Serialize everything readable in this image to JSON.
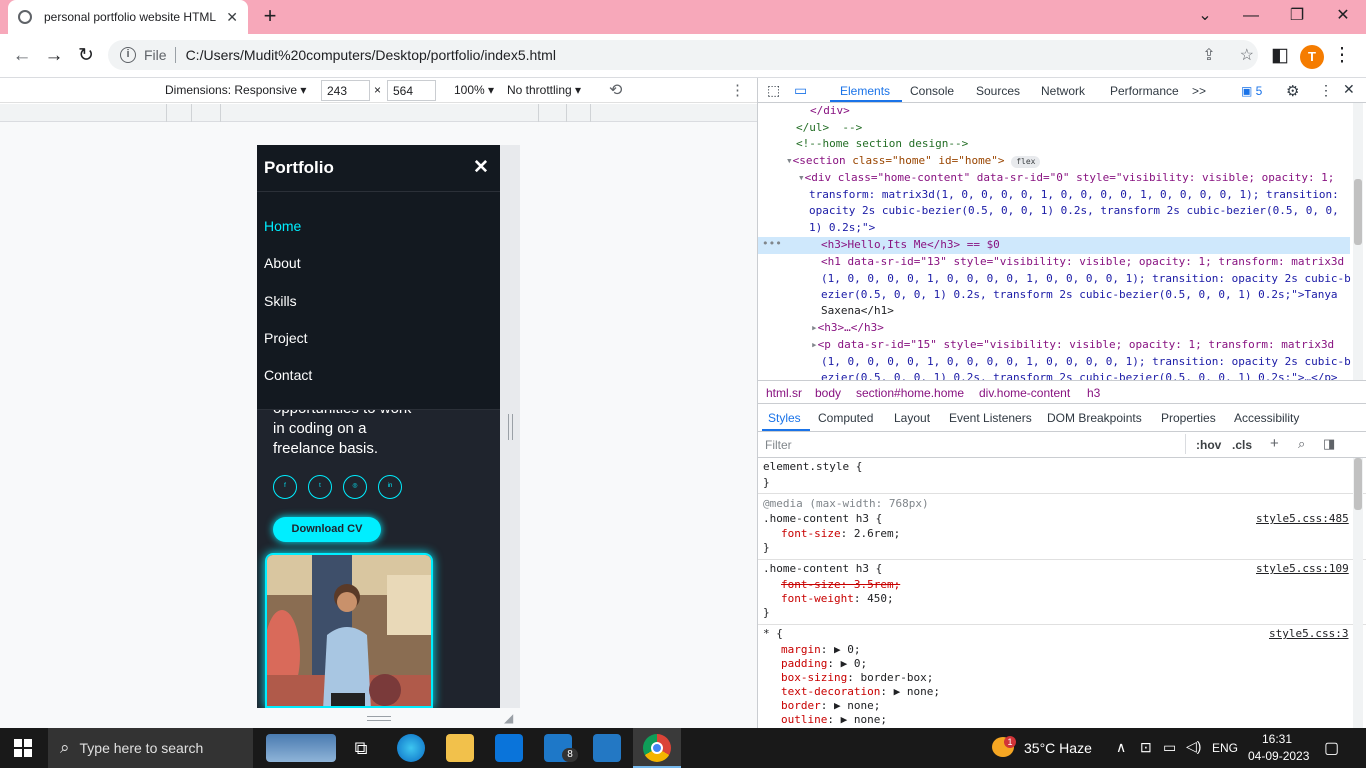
{
  "browser": {
    "tab_title": "personal portfolio website HTML",
    "url_scheme": "File",
    "url": "C:/Users/Mudit%20computers/Desktop/portfolio/index5.html",
    "profile_initial": "T"
  },
  "device_toolbar": {
    "dimensions_label": "Dimensions: Responsive",
    "width": "243",
    "times": "×",
    "height": "564",
    "zoom": "100%",
    "throttling": "No throttling"
  },
  "site": {
    "logo": "Portfolio",
    "close": "✕",
    "nav": [
      "Home",
      "About",
      "Skills",
      "Project",
      "Contact"
    ],
    "active_nav": "Home",
    "description_lines": [
      "opportunities to work",
      "in coding on a",
      "freelance basis."
    ],
    "social_icons": [
      "f",
      "t",
      "◎",
      "in"
    ],
    "download_label": "Download CV",
    "accent_color": "#00eeff",
    "background_color": "#1f242d"
  },
  "devtools": {
    "tabs": [
      "Elements",
      "Console",
      "Sources",
      "Network",
      "Performance",
      ">>"
    ],
    "active_tab": "Elements",
    "issues_count": "5",
    "dom_lines": {
      "l1": "</div>",
      "l2": "</ul>  -->",
      "l3": "<!--home section design-->",
      "l4a": "<section",
      "l4b": "class=\"home\" id=\"home\">",
      "l4badge": "flex",
      "l5": "<div class=\"home-content\" data-sr-id=\"0\" style=\"visibility: visible; opacity: 1;",
      "l6": "transform: matrix3d(1, 0, 0, 0, 0, 1, 0, 0, 0, 0, 1, 0, 0, 0, 0, 1); transition:",
      "l7": "opacity 2s cubic-bezier(0.5, 0, 0, 1) 0.2s, transform 2s cubic-bezier(0.5, 0, 0,",
      "l8": "1) 0.2s;\">",
      "l9": "<h3>Hello,Its Me</h3> == $0",
      "l10": "<h1 data-sr-id=\"13\" style=\"visibility: visible; opacity: 1; transform: matrix3d",
      "l11": "(1, 0, 0, 0, 0, 1, 0, 0, 0, 0, 1, 0, 0, 0, 0, 1); transition: opacity 2s cubic-b",
      "l12": "ezier(0.5, 0, 0, 1) 0.2s, transform 2s cubic-bezier(0.5, 0, 0, 1) 0.2s;\">Tanya",
      "l13": "Saxena</h1>",
      "l14": "<h3>…</h3>",
      "l15": "<p data-sr-id=\"15\" style=\"visibility: visible; opacity: 1; transform: matrix3d",
      "l16": "(1, 0, 0, 0, 0, 1, 0, 0, 0, 0, 1, 0, 0, 0, 0, 1); transition: opacity 2s cubic-b",
      "l17": "ezier(0.5, 0, 0, 1) 0.2s, transform 2s cubic-bezier(0.5, 0, 0, 1) 0.2s;\">…</p>"
    },
    "breadcrumbs": [
      "html.sr",
      "body",
      "section#home.home",
      "div.home-content",
      "h3"
    ],
    "style_tabs": [
      "Styles",
      "Computed",
      "Layout",
      "Event Listeners",
      "DOM Breakpoints",
      "Properties",
      "Accessibility"
    ],
    "filter_placeholder": "Filter",
    "hov": ":hov",
    "cls": ".cls",
    "rules": {
      "r1": "element.style {",
      "r1e": "}",
      "r2m": "@media (max-width: 768px)",
      "r2s": ".home-content h3 {",
      "r2src": "style5.css:485",
      "r2p": "font-size",
      "r2v": "2.6rem;",
      "r2e": "}",
      "r3s": ".home-content h3 {",
      "r3src": "style5.css:109",
      "r3p1": "font-size: 3.5rem;",
      "r3p2": "font-weight",
      "r3v2": "450;",
      "r3e": "}",
      "r4s": "* {",
      "r4src": "style5.css:3",
      "r4p1": "margin",
      "r4v1": "▶ 0;",
      "r4p2": "padding",
      "r4v2": "▶ 0;",
      "r4p3": "box-sizing",
      "r4v3": "border-box;",
      "r4p4": "text-decoration",
      "r4v4": "▶ none;",
      "r4p5": "border",
      "r4v5": "▶ none;",
      "r4p6": "outline",
      "r4v6": "▶ none;"
    }
  },
  "taskbar": {
    "search_placeholder": "Type here to search",
    "mail_badge": "8",
    "weather": "35°C  Haze",
    "weather_badge": "1",
    "lang": "ENG",
    "time": "16:31",
    "date": "04-09-2023"
  }
}
